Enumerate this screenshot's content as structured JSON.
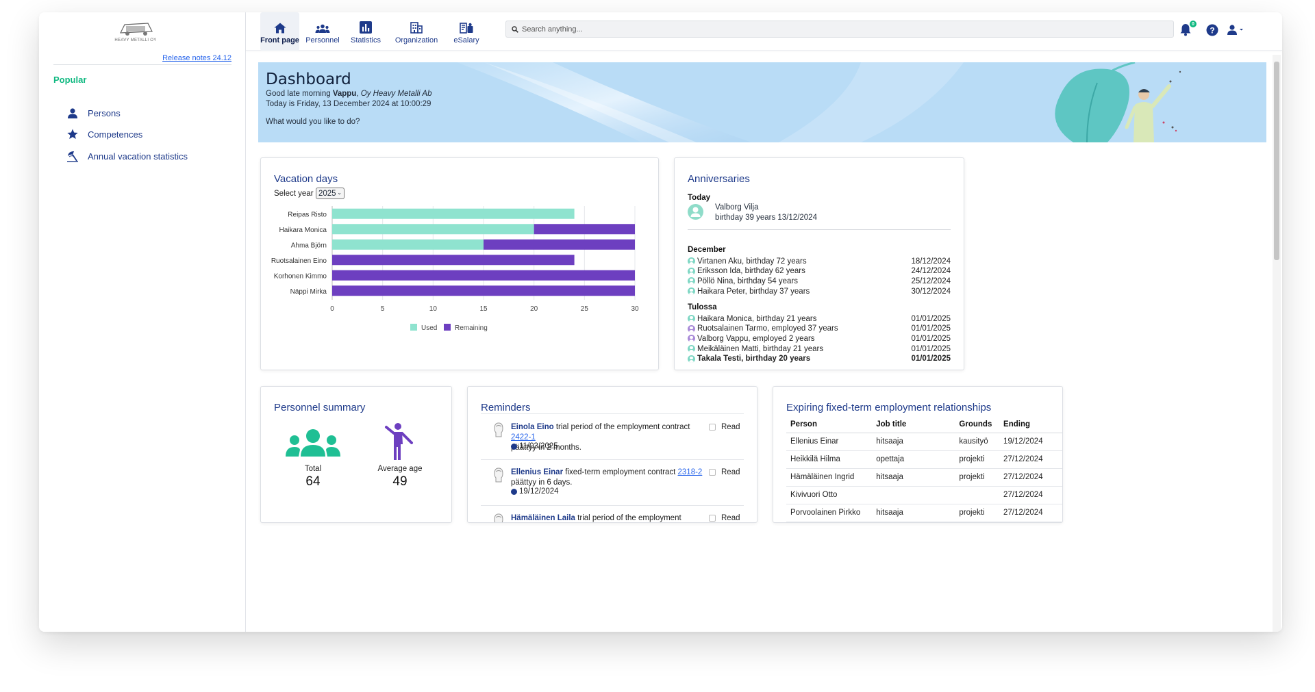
{
  "sidebar": {
    "logo_caption": "HEAVY METALLI OY",
    "release_notes": "Release notes 24.12",
    "popular_title": "Popular",
    "items": [
      {
        "label": "Persons",
        "icon": "person-icon"
      },
      {
        "label": "Competences",
        "icon": "star-icon"
      },
      {
        "label": "Annual vacation statistics",
        "icon": "beach-umbrella-icon"
      }
    ]
  },
  "nav": {
    "tabs": [
      {
        "label": "Front page",
        "icon": "home-icon",
        "active": true
      },
      {
        "label": "Personnel",
        "icon": "people-icon"
      },
      {
        "label": "Statistics",
        "icon": "bar-chart-icon"
      },
      {
        "label": "Organization",
        "icon": "building-icon"
      },
      {
        "label": "eSalary",
        "icon": "salary-icon"
      }
    ],
    "search_placeholder": "Search anything...",
    "notification_count": "0"
  },
  "banner": {
    "title": "Dashboard",
    "greeting_prefix": "Good late morning ",
    "user_name": "Vappu",
    "company": "Oy Heavy Metalli Ab",
    "today": "Today is Friday, 13 December 2024 at 10:00:29",
    "prompt": "What would you like to do?"
  },
  "vacation": {
    "title": "Vacation days",
    "select_label": "Select year",
    "selected_year": "2025"
  },
  "chart_data": {
    "type": "bar",
    "orientation": "horizontal",
    "stacked": true,
    "categories": [
      "Reipas Risto",
      "Haikara Monica",
      "Ahma Björn",
      "Ruotsalainen Eino",
      "Korhonen Kimmo",
      "Näppi Mirka"
    ],
    "series": [
      {
        "name": "Used",
        "color": "#8fe3cf",
        "values": [
          24,
          20,
          15,
          0,
          0,
          0
        ]
      },
      {
        "name": "Remaining",
        "color": "#6d3fc0",
        "values": [
          0,
          10,
          15,
          24,
          30,
          30
        ]
      }
    ],
    "xlim": [
      0,
      30
    ],
    "xticks": [
      "0",
      "5",
      "10",
      "15",
      "20",
      "25",
      "30"
    ],
    "legend": "bottom"
  },
  "anniversaries": {
    "title": "Anniversaries",
    "today_label": "Today",
    "today_name": "Valborg Vilja",
    "today_detail": "birthday 39 years 13/12/2024",
    "sections": [
      {
        "label": "December",
        "rows": [
          {
            "text": "Virtanen Aku, birthday 72 years",
            "date": "18/12/2024",
            "color": "#7fd7c4"
          },
          {
            "text": "Eriksson Ida, birthday 62 years",
            "date": "24/12/2024",
            "color": "#7fd7c4"
          },
          {
            "text": "Pöllö Nina, birthday 54 years",
            "date": "25/12/2024",
            "color": "#7fd7c4"
          },
          {
            "text": "Haikara Peter, birthday 37 years",
            "date": "30/12/2024",
            "color": "#7fd7c4"
          }
        ]
      },
      {
        "label": "Tulossa",
        "rows": [
          {
            "text": "Haikara Monica, birthday 21 years",
            "date": "01/01/2025",
            "color": "#7fd7c4"
          },
          {
            "text": "Ruotsalainen Tarmo, employed 37 years",
            "date": "01/01/2025",
            "color": "#a98ad8"
          },
          {
            "text": "Valborg Vappu, employed 2 years",
            "date": "01/01/2025",
            "color": "#a98ad8"
          },
          {
            "text": "Meikäläinen Matti, birthday 21 years",
            "date": "01/01/2025",
            "color": "#7fd7c4"
          },
          {
            "text": "Takala Testi, birthday 20 years",
            "date": "01/01/2025",
            "color": "#7fd7c4",
            "bold": true
          }
        ]
      }
    ]
  },
  "personnel_summary": {
    "title": "Personnel summary",
    "total_label": "Total",
    "total_value": "64",
    "age_label": "Average age",
    "age_value": "49"
  },
  "reminders": {
    "title": "Reminders",
    "read_label": "Read",
    "items": [
      {
        "name": "Einola Eino",
        "text": " trial period of the employment contract ",
        "link": "2422-1",
        "line2": "päättyy in 2 months.",
        "date": "11/03/2025"
      },
      {
        "name": "Ellenius Einar",
        "text": " fixed-term employment contract ",
        "link": "2318-2",
        "line2": "päättyy in 6 days.",
        "date": "19/12/2024"
      },
      {
        "name": "Hämäläinen Laila",
        "text": " trial period of the employment contract",
        "link": "",
        "line2": "",
        "date": ""
      }
    ]
  },
  "expiring": {
    "title": "Expiring fixed-term employment relationships",
    "columns": [
      "Person",
      "Job title",
      "Grounds",
      "Ending"
    ],
    "rows": [
      [
        "Ellenius Einar",
        "hitsaaja",
        "kausityö",
        "19/12/2024"
      ],
      [
        "Heikkilä Hilma",
        "opettaja",
        "projekti",
        "27/12/2024"
      ],
      [
        "Hämäläinen Ingrid",
        "hitsaaja",
        "projekti",
        "27/12/2024"
      ],
      [
        "Kivivuori Otto",
        "",
        "",
        "27/12/2024"
      ],
      [
        "Porvoolainen Pirkko",
        "hitsaaja",
        "projekti",
        "27/12/2024"
      ]
    ]
  },
  "colors": {
    "accent_teal": "#10b981",
    "navy": "#1e3a8a",
    "used_bar": "#8fe3cf",
    "remaining_bar": "#6d3fc0",
    "banner_bg": "#b9dcf6"
  }
}
